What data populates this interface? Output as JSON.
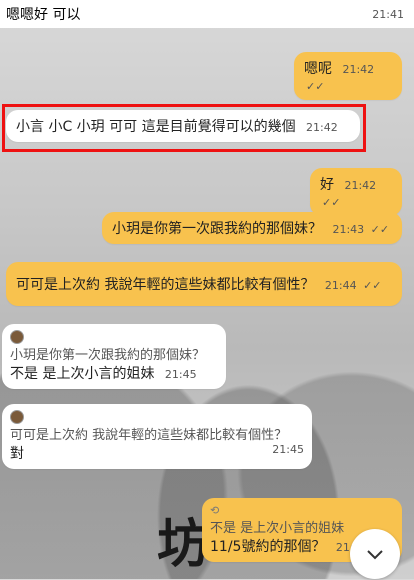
{
  "top": {
    "text": "嗯嗯好 可以",
    "time": "21:41"
  },
  "messages": [
    {
      "text": "嗯呢",
      "time": "21:42",
      "tick": "✓✓"
    },
    {
      "text": "小言 小C 小玥 可可 這是目前覺得可以的幾個",
      "time": "21:42"
    },
    {
      "text": "好",
      "time": "21:42",
      "tick": "✓✓"
    },
    {
      "text": "小玥是你第一次跟我約的那個妹？",
      "time": "21:43",
      "tick": "✓✓"
    },
    {
      "text": "可可是上次約 我說年輕的這些妹都比較有個性？",
      "time": "21:44",
      "tick": "✓✓"
    }
  ],
  "reply1": {
    "quote": "小玥是你第一次跟我約的那個妹？",
    "text": "不是 是上次小言的姐妹",
    "time": "21:45"
  },
  "reply2": {
    "quote": "可可是上次約 我說年輕的這些妹都比較有個性？",
    "text": "對",
    "time": "21:45"
  },
  "reply3": {
    "quote": "不是 是上次小言的姐妹",
    "text": "11/5號約的那個？",
    "time": "21:4"
  },
  "background_text": "坊"
}
